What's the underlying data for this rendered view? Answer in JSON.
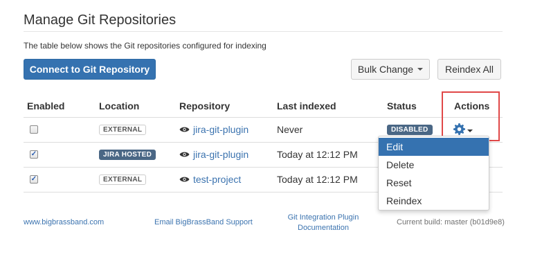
{
  "page": {
    "title": "Manage Git Repositories",
    "description": "The table below shows the Git repositories configured for indexing"
  },
  "toolbar": {
    "connect_label": "Connect to Git Repository",
    "bulk_change_label": "Bulk Change",
    "reindex_all_label": "Reindex All"
  },
  "table": {
    "headers": {
      "enabled": "Enabled",
      "location": "Location",
      "repository": "Repository",
      "last_indexed": "Last indexed",
      "status": "Status",
      "actions": "Actions"
    },
    "rows": [
      {
        "enabled": false,
        "enabled_mark": "",
        "location": "EXTERNAL",
        "repository": "jira-git-plugin",
        "last_indexed": "Never",
        "status": "DISABLED"
      },
      {
        "enabled": true,
        "enabled_mark": "✓",
        "location": "JIRA HOSTED",
        "repository": "jira-git-plugin",
        "last_indexed": "Today at 12:12 PM",
        "status": ""
      },
      {
        "enabled": true,
        "enabled_mark": "✓",
        "location": "EXTERNAL",
        "repository": "test-project",
        "last_indexed": "Today at 12:12 PM",
        "status": ""
      }
    ]
  },
  "actions_menu": {
    "items": [
      "Edit",
      "Delete",
      "Reset",
      "Reindex"
    ],
    "active_item": "Edit"
  },
  "footer": {
    "site_link": "www.bigbrassband.com",
    "support_link": "Email BigBrassBand Support",
    "docs_link_line1": "Git Integration Plugin",
    "docs_link_line2": "Documentation",
    "build": "Current build: master (b01d9e8)"
  },
  "colors": {
    "primary": "#3572b0",
    "link": "#3b73af",
    "status_dark": "#4a6785",
    "highlight": "#e04848"
  },
  "icons": {
    "repo": "eye-icon",
    "actions": "gear-icon",
    "dropdown": "caret-down-icon"
  }
}
